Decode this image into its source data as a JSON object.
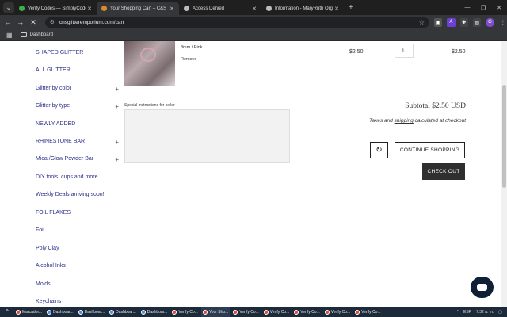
{
  "browser": {
    "tabs": [
      {
        "label": "Verify Codes — SimplyCodes",
        "color": "#3fae49"
      },
      {
        "label": "Your Shopping Cart – C&S Glitt",
        "color": "#d98a2b",
        "active": true
      },
      {
        "label": "Access Denied",
        "color": "#bbbbbb"
      },
      {
        "label": "Information - MaryRuth Organ",
        "color": "#bbbbbb"
      }
    ],
    "url": "cnsglitteremporium.com/cart",
    "bookmark": "Dashboard",
    "profile_initial": "G",
    "ext_a": "A"
  },
  "sidebar": {
    "items": [
      {
        "label": "SHAPED GLITTER",
        "plus": false
      },
      {
        "label": "ALL GLITTER",
        "plus": false
      },
      {
        "label": "Glitter by color",
        "plus": true
      },
      {
        "label": "Glitter by type",
        "plus": true
      },
      {
        "label": "NEWLY ADDED",
        "plus": false
      },
      {
        "label": "RHINESTONE BAR",
        "plus": true
      },
      {
        "label": "Mica /Glow Powder Bar",
        "plus": true
      },
      {
        "label": "DIY tools, cups and more",
        "plus": false
      },
      {
        "label": "Weekly Deals arriving soon!",
        "plus": false
      },
      {
        "label": "FOIL FLAKES",
        "plus": false
      },
      {
        "label": "Foil",
        "plus": false
      },
      {
        "label": "Poly Clay",
        "plus": false
      },
      {
        "label": "Alcohol Inks",
        "plus": false
      },
      {
        "label": "Molds",
        "plus": false
      },
      {
        "label": "Keychains",
        "plus": false
      }
    ],
    "plus_symbol": "+"
  },
  "cart": {
    "variant": "8mm / Pink",
    "remove": "Remove",
    "price": "$2.50",
    "quantity": "1",
    "line_total": "$2.50",
    "instructions_label": "Special instructions for seller",
    "subtotal": "Subtotal $2.50 USD",
    "taxes_prefix": "Taxes and ",
    "taxes_link": "shipping",
    "taxes_suffix": " calculated at checkout",
    "continue_label": "CONTINUE SHOPPING",
    "checkout_label": "CHECK OUT"
  },
  "taskbar": {
    "items": [
      {
        "label": "Marcador...",
        "color": "red"
      },
      {
        "label": "Dashboar...",
        "color": "blue"
      },
      {
        "label": "Dashboar...",
        "color": "blue"
      },
      {
        "label": "Dashboar...",
        "color": "blue"
      },
      {
        "label": "Dashboar...",
        "color": "blue"
      },
      {
        "label": "Verify Co...",
        "color": "red"
      },
      {
        "label": "Your Sho...",
        "color": "red",
        "active": true
      },
      {
        "label": "Verify Co...",
        "color": "red"
      },
      {
        "label": "Verify Co...",
        "color": "red"
      },
      {
        "label": "Verify Co...",
        "color": "red"
      },
      {
        "label": "Verify Co...",
        "color": "red"
      },
      {
        "label": "Verify Co...",
        "color": "red"
      }
    ],
    "lang": "ESP",
    "time": "7:32 a. m."
  }
}
